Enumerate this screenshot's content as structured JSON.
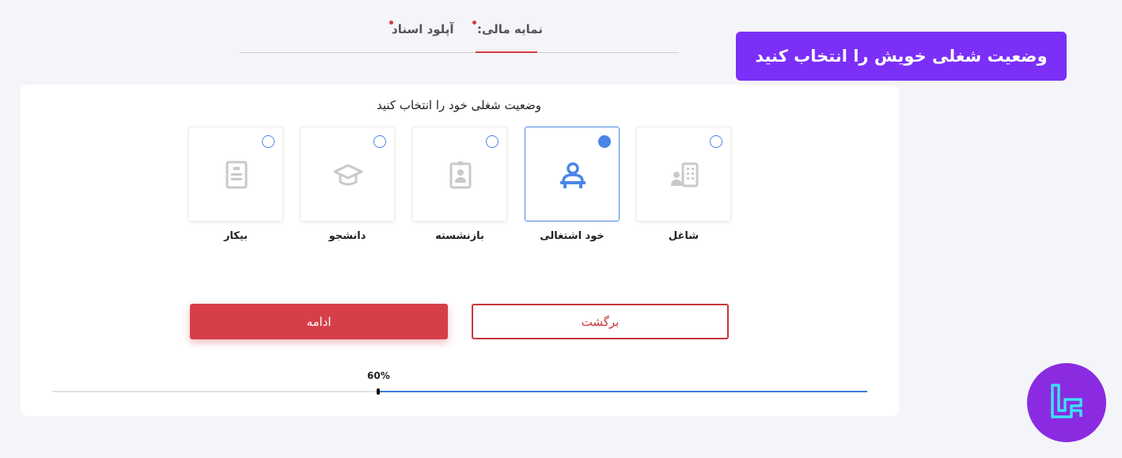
{
  "tabs": {
    "finance": "نمایه مالی:",
    "upload": "آپلود اسناد"
  },
  "banner": {
    "text": "وضعیت شغلی خویش را انتخاب کنید"
  },
  "form": {
    "question": "وضعیت شغلی خود را انتخاب کنید",
    "options": [
      {
        "label": "شاغل",
        "icon": "building-person-icon",
        "selected": false
      },
      {
        "label": "خود اشتغالی",
        "icon": "person-desk-icon",
        "selected": true
      },
      {
        "label": "بازنشسته",
        "icon": "id-badge-icon",
        "selected": false
      },
      {
        "label": "دانشجو",
        "icon": "graduation-cap-icon",
        "selected": false
      },
      {
        "label": "بیکار",
        "icon": "document-icon",
        "selected": false
      }
    ]
  },
  "buttons": {
    "back": "برگشت",
    "continue": "ادامه"
  },
  "progress": {
    "label": "60%",
    "value": 0.6
  },
  "colors": {
    "accent_red": "#d63f47",
    "accent_blue": "#4a86e8",
    "banner_purple": "#7b2ff7",
    "logo_purple": "#8a2be2"
  }
}
